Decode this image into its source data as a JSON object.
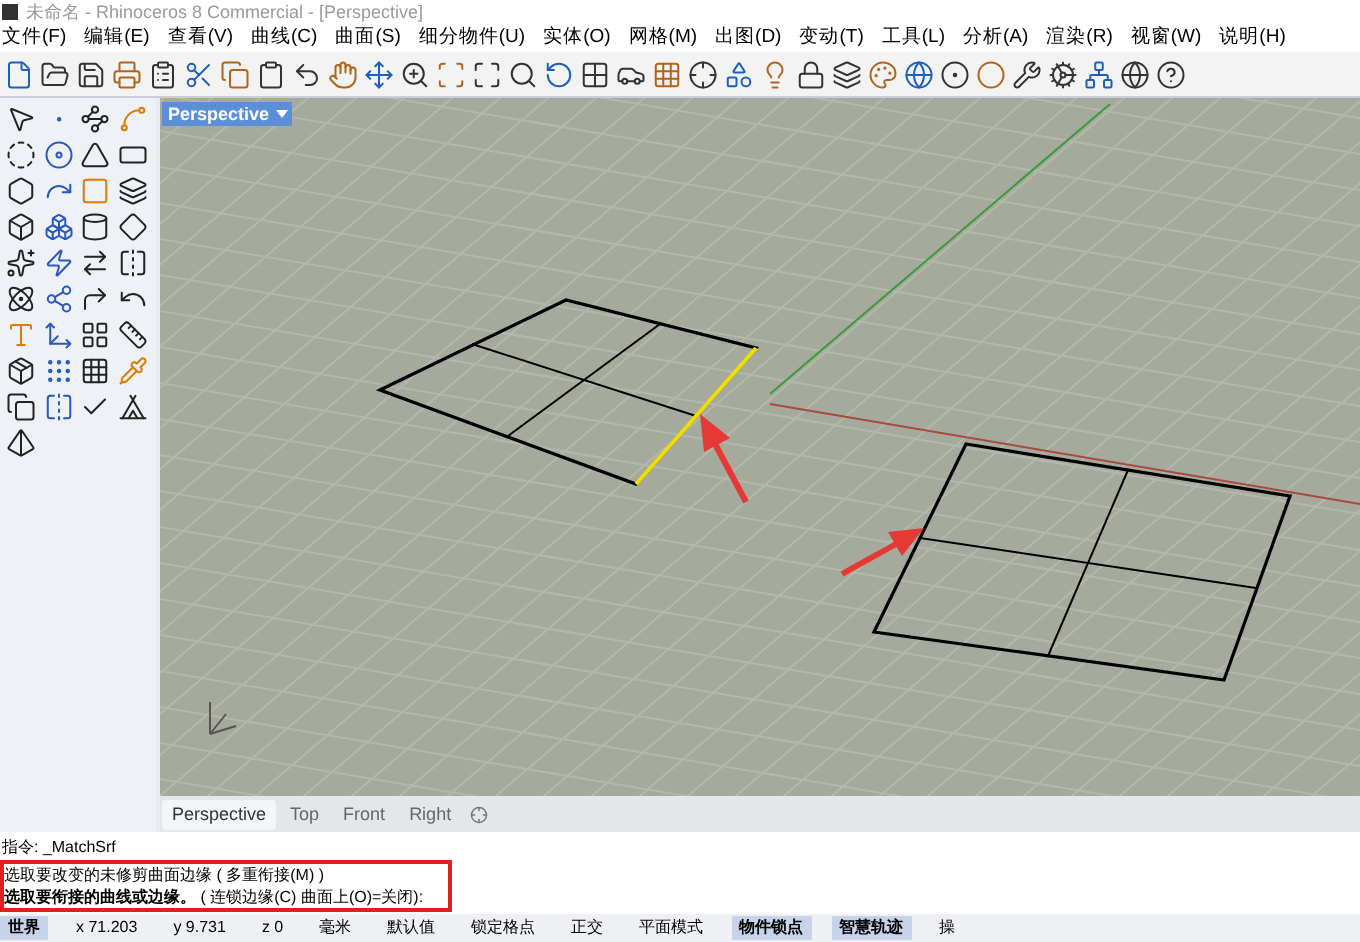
{
  "window": {
    "title": "未命名 - Rhinoceros 8 Commercial - [Perspective]"
  },
  "menu": [
    "文件(F)",
    "编辑(E)",
    "查看(V)",
    "曲线(C)",
    "曲面(S)",
    "细分物件(U)",
    "实体(O)",
    "网格(M)",
    "出图(D)",
    "变动(T)",
    "工具(L)",
    "分析(A)",
    "渲染(R)",
    "视窗(W)",
    "说明(H)"
  ],
  "viewport": {
    "label": "Perspective"
  },
  "viewport_tabs": [
    {
      "label": "Perspective",
      "selected": true
    },
    {
      "label": "Top",
      "selected": false
    },
    {
      "label": "Front",
      "selected": false
    },
    {
      "label": "Right",
      "selected": false
    }
  ],
  "command": {
    "lines": [
      "指令: _MatchSrf",
      "选取要改变的未修剪曲面边缘 ( 多重衔接(M) )",
      "**选取要衔接的曲线或边缘。** ( 连锁边缘(C)  曲面上(O)=关闭):"
    ]
  },
  "status_bar": [
    {
      "label": "世界",
      "on": true
    },
    {
      "label": "x 71.203",
      "on": false
    },
    {
      "label": "y 9.731",
      "on": false
    },
    {
      "label": "z 0",
      "on": false
    },
    {
      "label": "毫米",
      "on": false
    },
    {
      "label": "默认值",
      "on": false
    },
    {
      "label": "锁定格点",
      "on": false
    },
    {
      "label": "正交",
      "on": false
    },
    {
      "label": "平面模式",
      "on": false
    },
    {
      "label": "物件锁点",
      "on": true
    },
    {
      "label": "智慧轨迹",
      "on": true
    },
    {
      "label": "操",
      "on": false
    }
  ]
}
